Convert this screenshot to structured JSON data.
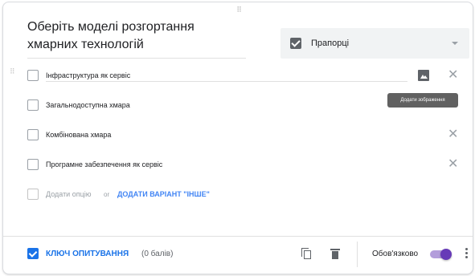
{
  "question": {
    "title": "Оберіть моделі розгортання хмарних технологій",
    "type_label": "Прапорці"
  },
  "options": [
    {
      "label": "Інфраструктура як сервіс"
    },
    {
      "label": "Загальнодоступна хмара"
    },
    {
      "label": "Комбінована хмара"
    },
    {
      "label": "Програмне забезпечення як сервіс"
    }
  ],
  "add_option": {
    "text": "Додати опцію",
    "or": "or",
    "add_other": "ДОДАТИ ВАРІАНТ \"ІНШЕ\""
  },
  "tooltip": "Додати зображення",
  "footer": {
    "answer_key": "КЛЮЧ ОПИТУВАННЯ",
    "points": "(0 балів)",
    "required": "Обов'язково"
  },
  "icons": {
    "drag_handle": "drag-handle-icon",
    "checkbox": "checkbox-icon",
    "dropdown": "caret-down-icon",
    "image": "image-icon",
    "close": "close-icon",
    "answer_key": "answer-key-icon",
    "copy": "copy-icon",
    "delete": "delete-icon",
    "more": "more-vert-icon"
  },
  "colors": {
    "accent": "#673ab7",
    "link": "#1a73e8"
  }
}
